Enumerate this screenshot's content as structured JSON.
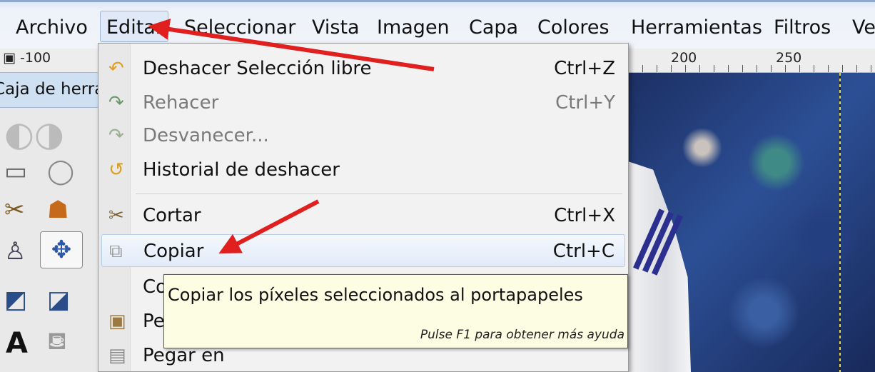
{
  "menubar": {
    "items": [
      "Archivo",
      "Editar",
      "Seleccionar",
      "Vista",
      "Imagen",
      "Capa",
      "Colores",
      "Herramientas",
      "Filtros",
      "Ve"
    ],
    "active": "Editar"
  },
  "ruler": {
    "labels": [
      "-100",
      "200",
      "250"
    ]
  },
  "toolbox": {
    "title": "Caja de herramientas"
  },
  "edit_menu": {
    "items": [
      {
        "label": "Deshacer Selección libre",
        "shortcut": "Ctrl+Z",
        "icon": "undo-icon",
        "disabled": false
      },
      {
        "label": "Rehacer",
        "shortcut": "Ctrl+Y",
        "icon": "redo-icon",
        "disabled": true
      },
      {
        "label": "Desvanecer...",
        "shortcut": "",
        "icon": "fade-icon",
        "disabled": true
      },
      {
        "label": "Historial de deshacer",
        "shortcut": "",
        "icon": "history-icon",
        "disabled": false
      },
      {
        "label": "Cortar",
        "shortcut": "Ctrl+X",
        "icon": "scissors-icon",
        "disabled": false
      },
      {
        "label": "Copiar",
        "shortcut": "Ctrl+C",
        "icon": "copy-icon",
        "disabled": false
      },
      {
        "label": "Co",
        "shortcut": "",
        "icon": "",
        "disabled": false
      },
      {
        "label": "Pe",
        "shortcut": "",
        "icon": "paste-icon",
        "disabled": false
      },
      {
        "label": "Pegar en",
        "shortcut": "",
        "icon": "paste-into-icon",
        "disabled": false
      }
    ],
    "highlighted": "Copiar"
  },
  "tooltip": {
    "text": "Copiar los píxeles seleccionados al portapapeles",
    "hint": "Pulse F1 para obtener más ayuda"
  },
  "annotation_color": "#e0201e"
}
